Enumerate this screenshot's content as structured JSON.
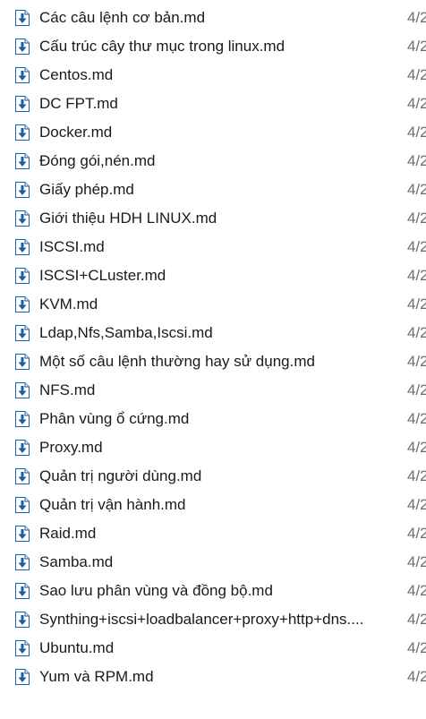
{
  "file_list": {
    "rows": [
      {
        "name": "Các câu lệnh cơ bản.md",
        "date": "4/2",
        "icon": "markdown-file-icon"
      },
      {
        "name": "Cấu trúc cây thư mục trong linux.md",
        "date": "4/2",
        "icon": "markdown-file-icon"
      },
      {
        "name": "Centos.md",
        "date": "4/2",
        "icon": "markdown-file-icon"
      },
      {
        "name": "DC FPT.md",
        "date": "4/2",
        "icon": "markdown-file-icon"
      },
      {
        "name": "Docker.md",
        "date": "4/2",
        "icon": "markdown-file-icon"
      },
      {
        "name": "Đóng gói,nén.md",
        "date": "4/2",
        "icon": "markdown-file-icon"
      },
      {
        "name": "Giấy phép.md",
        "date": "4/2",
        "icon": "markdown-file-icon"
      },
      {
        "name": "Giới thiệu HDH LINUX.md",
        "date": "4/2",
        "icon": "markdown-file-icon"
      },
      {
        "name": "ISCSI.md",
        "date": "4/2",
        "icon": "markdown-file-icon"
      },
      {
        "name": "ISCSI+CLuster.md",
        "date": "4/2",
        "icon": "markdown-file-icon"
      },
      {
        "name": "KVM.md",
        "date": "4/2",
        "icon": "markdown-file-icon"
      },
      {
        "name": "Ldap,Nfs,Samba,Iscsi.md",
        "date": "4/2",
        "icon": "markdown-file-icon"
      },
      {
        "name": "Một số câu lệnh thường hay sử dụng.md",
        "date": "4/2",
        "icon": "markdown-file-icon"
      },
      {
        "name": "NFS.md",
        "date": "4/2",
        "icon": "markdown-file-icon"
      },
      {
        "name": "Phân vùng ổ cứng.md",
        "date": "4/2",
        "icon": "markdown-file-icon"
      },
      {
        "name": "Proxy.md",
        "date": "4/2",
        "icon": "markdown-file-icon"
      },
      {
        "name": "Quản trị người dùng.md",
        "date": "4/2",
        "icon": "markdown-file-icon"
      },
      {
        "name": "Quản trị vận hành.md",
        "date": "4/2",
        "icon": "markdown-file-icon"
      },
      {
        "name": "Raid.md",
        "date": "4/2",
        "icon": "markdown-file-icon"
      },
      {
        "name": "Samba.md",
        "date": "4/2",
        "icon": "markdown-file-icon"
      },
      {
        "name": "Sao lưu phân vùng và đồng bộ.md",
        "date": "4/2",
        "icon": "markdown-file-icon"
      },
      {
        "name": "Synthing+iscsi+loadbalancer+proxy+http+dns....",
        "date": "4/2",
        "icon": "markdown-file-icon"
      },
      {
        "name": "Ubuntu.md",
        "date": "4/2",
        "icon": "markdown-file-icon"
      },
      {
        "name": "Yum và RPM.md",
        "date": "4/2",
        "icon": "markdown-file-icon"
      }
    ]
  }
}
